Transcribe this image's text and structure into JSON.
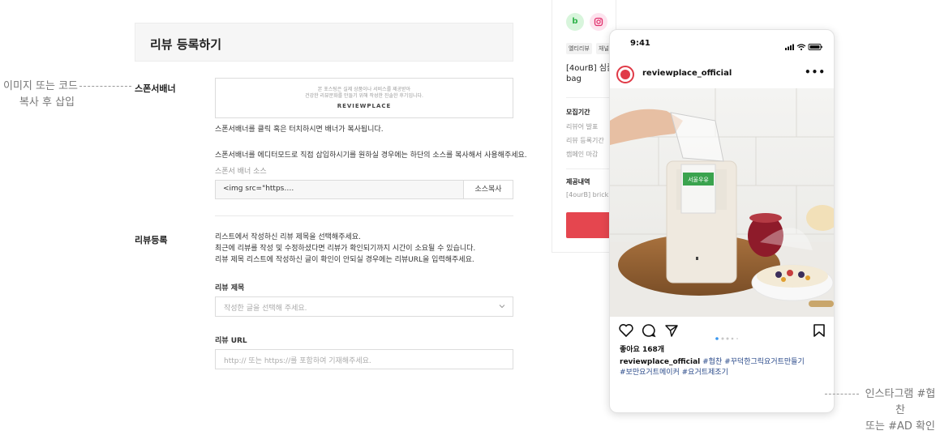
{
  "annotations": {
    "left_line1": "이미지 또는 코드",
    "left_line2": "복사 후 삽입",
    "right_line1": "인스타그램 #협찬",
    "right_line2": "또는 #AD 확인"
  },
  "form": {
    "title": "리뷰 등록하기",
    "sponsor": {
      "label": "스폰서배너",
      "banner_line1": "본 포스팅은 실제 상품이나 서비스를 제공받아",
      "banner_line2": "건강한 리뷰문화를 만들기 위해 작성한 진솔한 후기입니다.",
      "banner_logo": "REVIEWPLACE",
      "click_help": "스폰서배너를 클릭 혹은 터치하시면 배너가 복사됩니다.",
      "editor_help": "스폰서배너를 에디터모드로 직접 삽입하시기를 원하실 경우에는 하단의 소스를 복사해서 사용해주세요.",
      "source_label": "스폰서 배너 소스",
      "source_value": "<img src=\"https….",
      "copy_button": "소스복사"
    },
    "review": {
      "label": "리뷰등록",
      "help1": "리스트에서 작성하신 리뷰 제목을 선택해주세요.",
      "help2": "최근에 리뷰를 작성 및 수정하셨다면 리뷰가 확인되기까지 시간이 소요될 수 있습니다.",
      "help3": "리뷰 제목 리스트에 작성하신 글이 확인이 안되실 경우에는 리뷰URL을 입력해주세요.",
      "title_label": "리뷰 제목",
      "title_placeholder": "작성한 글을 선택해 주세요.",
      "url_label": "리뷰 URL",
      "url_placeholder": "http:// 또는 https://를 포함하여 기재해주세요."
    }
  },
  "side_panel": {
    "badge_b": "b",
    "chip1": "옐티리뷰",
    "chip2": "채널",
    "product_line1": "[4ourB] 심플",
    "product_line2": "bag",
    "recruit_title": "모집기간",
    "reviewer_announce": "리뷰어 발표",
    "review_period": "리뷰 등록기간",
    "campaign_end": "캠페인 마감",
    "provide_title": "제공내역",
    "provide_value": "[4ourB] brick"
  },
  "phone": {
    "time": "9:41",
    "username": "reviewplace_official",
    "likes": "좋아요 168개",
    "caption_user": "reviewplace_official",
    "caption_tags_1": "#협찬 #꾸덕한그릭요거트만들기",
    "caption_tags_2": "#보만요거트메이커 #요거트제조기",
    "product_label": "서울우유"
  },
  "colors": {
    "accent_red": "#e5464f",
    "hashtag_blue": "#2a4a8a",
    "blog_green": "#2fb34a",
    "insta_pink": "#e1306c"
  },
  "icons": [
    "heart-icon",
    "comment-icon",
    "share-icon",
    "bookmark-icon",
    "more-icon",
    "signal-icon",
    "wifi-icon",
    "battery-icon",
    "chevron-down-icon",
    "instagram-icon",
    "blog-icon"
  ]
}
